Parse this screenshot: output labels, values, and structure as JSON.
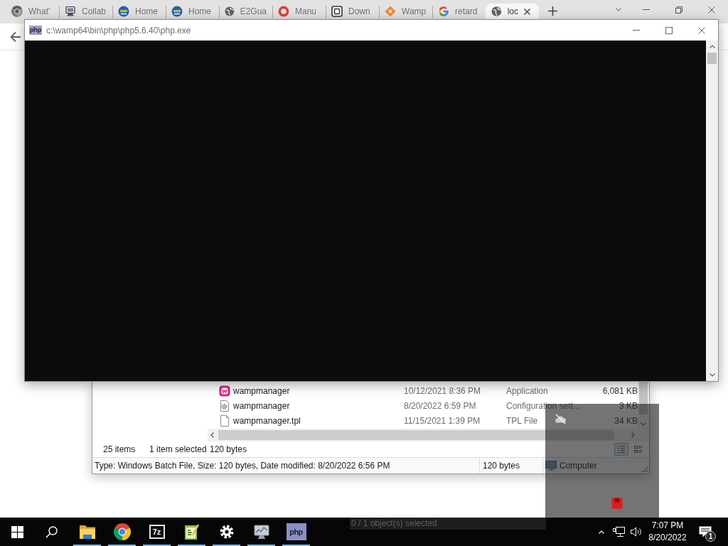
{
  "browser": {
    "tabs": [
      {
        "title": "What'",
        "kind": "chrome",
        "selected": false
      },
      {
        "title": "Collab",
        "kind": "computer",
        "selected": false
      },
      {
        "title": "Home",
        "kind": "pbs",
        "selected": false
      },
      {
        "title": "Home",
        "kind": "pbs",
        "selected": false
      },
      {
        "title": "E2Gua",
        "kind": "globe",
        "selected": false
      },
      {
        "title": "Manu",
        "kind": "ring",
        "selected": false
      },
      {
        "title": "Down",
        "kind": "box",
        "selected": false
      },
      {
        "title": "Wamp",
        "kind": "diamond",
        "selected": false
      },
      {
        "title": "retard",
        "kind": "google",
        "selected": false
      },
      {
        "title": "loc",
        "kind": "globe",
        "selected": true
      }
    ]
  },
  "console": {
    "title": "c:\\wamp64\\bin\\php\\php5.6.40\\php.exe",
    "icon_label": "php"
  },
  "explorer": {
    "files": [
      {
        "kind": "app",
        "name": "wampmanager",
        "modified": "10/12/2021 8:36 PM",
        "type": "Application",
        "size": "6,081 KB"
      },
      {
        "kind": "config",
        "name": "wampmanager",
        "modified": "8/20/2022 6:59 PM",
        "type": "Configuration sett...",
        "size": "3 KB"
      },
      {
        "kind": "file",
        "name": "wampmanager.tpl",
        "modified": "11/15/2021 1:39 PM",
        "type": "TPL File",
        "size": "34 KB"
      }
    ],
    "status": {
      "item_count": "25 items",
      "selection": "1 item selected",
      "selection_size": "120 bytes"
    },
    "views": [
      {
        "kind": "details",
        "selected": true
      },
      {
        "kind": "tiles",
        "selected": false
      }
    ],
    "details_bar": {
      "info": "Type: Windows Batch File, Size: 120 bytes, Date modified: 8/20/2022 6:56 PM",
      "size": "120 bytes",
      "location": "Computer"
    }
  },
  "selection_strip": {
    "text": "0 / 1 object(s) selected"
  },
  "taskbar": {
    "apps": [
      {
        "kind": "explorer",
        "running": true
      },
      {
        "kind": "chrome",
        "running": true
      },
      {
        "kind": "archiver",
        "label": "7z",
        "running": true
      },
      {
        "kind": "notepad",
        "running": true
      },
      {
        "kind": "settings",
        "running": true
      },
      {
        "kind": "monitor",
        "running": true
      },
      {
        "kind": "php",
        "label": "php",
        "running": true
      }
    ],
    "time": "7:07 PM",
    "date": "8/20/2022",
    "notifications": "1"
  }
}
